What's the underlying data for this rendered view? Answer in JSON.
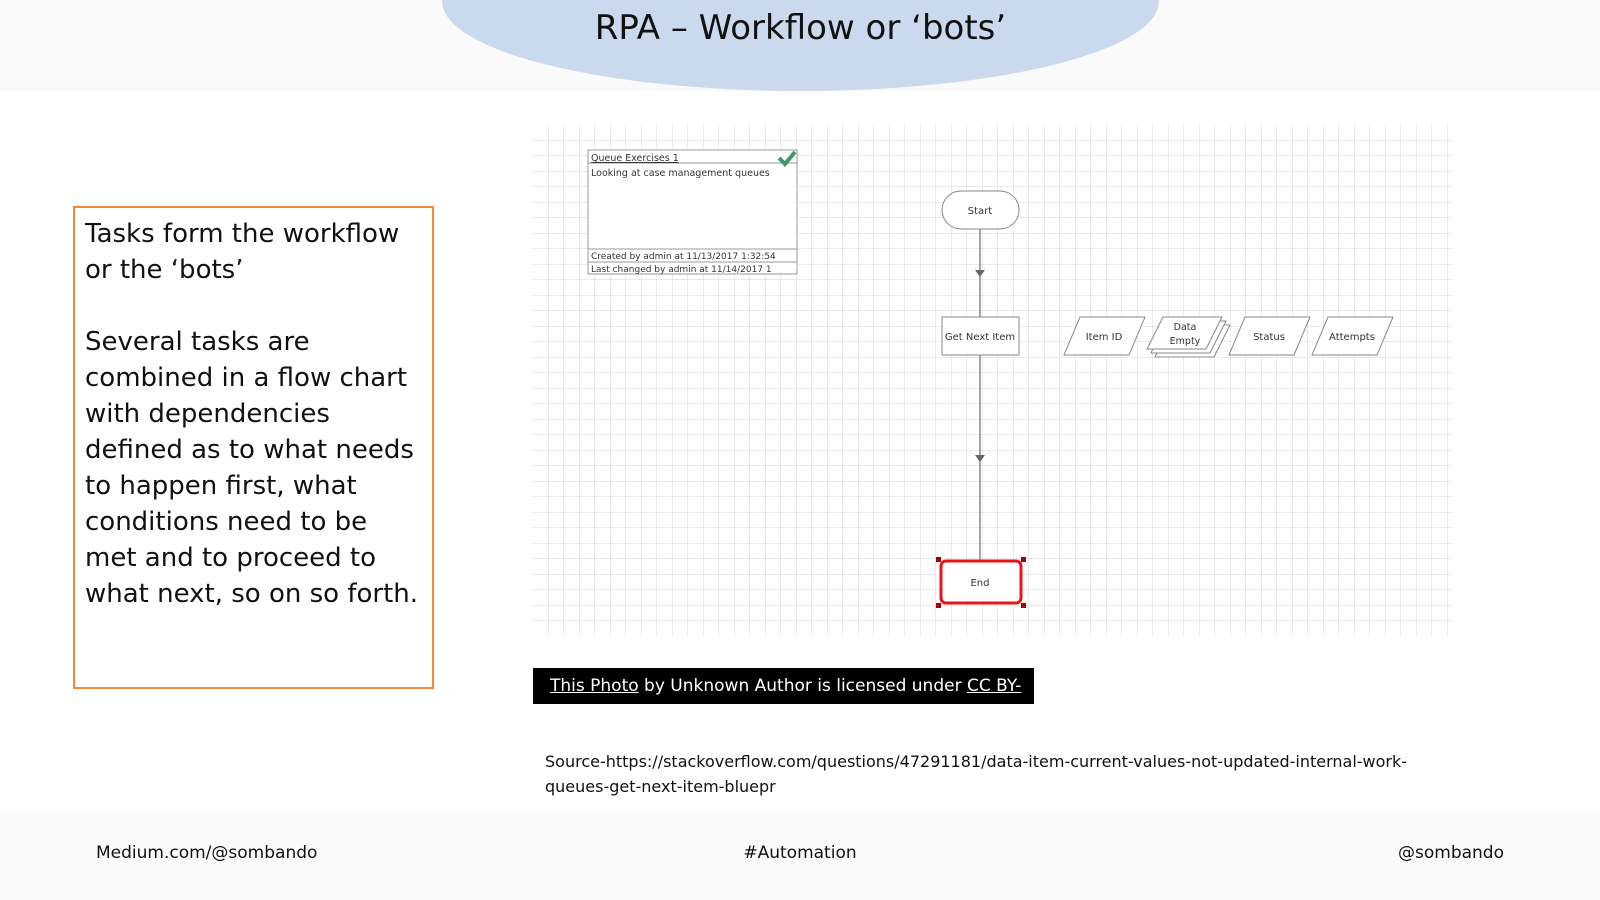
{
  "slide": {
    "title": "RPA – Workflow or ‘bots’"
  },
  "textbox": {
    "para1": "Tasks form the workflow or the ‘bots’",
    "para2": "Several tasks are combined in a flow chart with dependencies defined as to what needs to happen first, what conditions need to be met and to proceed to what next, so on so forth."
  },
  "diagram": {
    "info_box": {
      "title": "Queue Exercises 1",
      "description": "Looking at case management queues",
      "created": "Created by admin at 11/13/2017 1:32:54",
      "changed": "Last changed by admin at 11/14/2017 1"
    },
    "nodes": {
      "start": "Start",
      "get_next": "Get Next Item",
      "end": "End",
      "item_id": "Item ID",
      "data_empty_1": "Data",
      "data_empty_2": "Empty",
      "status": "Status",
      "attempts": "Attempts"
    },
    "colors": {
      "selected": "#e8141c",
      "check": "#3a9a6a"
    }
  },
  "caption": {
    "link1": "This Photo",
    "middle": " by Unknown Author is licensed under ",
    "link2": "CC BY-SA"
  },
  "source": "Source-https://stackoverflow.com/questions/47291181/data-item-current-values-not-updated-internal-work-queues-get-next-item-bluepr",
  "footer": {
    "left": "Medium.com/@sombando",
    "center": "#Automation",
    "right": "@sombando"
  }
}
